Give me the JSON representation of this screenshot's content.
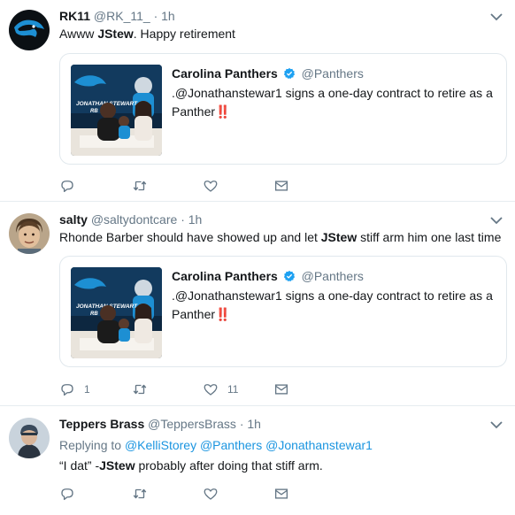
{
  "tweets": [
    {
      "name": "RK11",
      "handle": "@RK_11_",
      "time": "1h",
      "text_pre": "Awww ",
      "text_bold": "JStew",
      "text_post": ". Happy retirement",
      "quote": {
        "name": "Carolina Panthers",
        "handle": "@Panthers",
        "text": ".@Jonathanstewar1 signs a one-day contract to retire as a Panther",
        "emoji": "‼️",
        "image_caption": "JONATHAN STEWART",
        "image_caption_sub": "RB"
      },
      "reply_count": "",
      "retweet_count": "",
      "like_count": ""
    },
    {
      "name": "salty",
      "handle": "@saltydontcare",
      "time": "1h",
      "text_pre": "Rhonde Barber should have showed up and let ",
      "text_bold": "JStew",
      "text_post": " stiff arm him one last time",
      "quote": {
        "name": "Carolina Panthers",
        "handle": "@Panthers",
        "text": ".@Jonathanstewar1 signs a one-day contract to retire as a Panther",
        "emoji": "‼️",
        "image_caption": "JONATHAN STEWART",
        "image_caption_sub": "RB"
      },
      "reply_count": "1",
      "retweet_count": "",
      "like_count": "11"
    },
    {
      "name": "Teppers Brass",
      "handle": "@TeppersBrass",
      "time": "1h",
      "replying_to_label": "Replying to",
      "replying_to": [
        "@KelliStorey",
        "@Panthers",
        "@Jonathanstewar1"
      ],
      "text_pre": "“I dat” -",
      "text_bold": "JStew",
      "text_post": " probably after doing that stiff arm.",
      "reply_count": "",
      "retweet_count": "",
      "like_count": ""
    }
  ],
  "dot": "·",
  "icons": {
    "reply": "reply-icon",
    "retweet": "retweet-icon",
    "like": "heart-icon",
    "dm": "envelope-icon",
    "caret": "chevron-down-icon",
    "verified": "verified-badge-icon"
  },
  "colors": {
    "link": "#1b95e0",
    "secondary": "#657786",
    "verified": "#1da1f2",
    "border": "#e6ecf0"
  }
}
